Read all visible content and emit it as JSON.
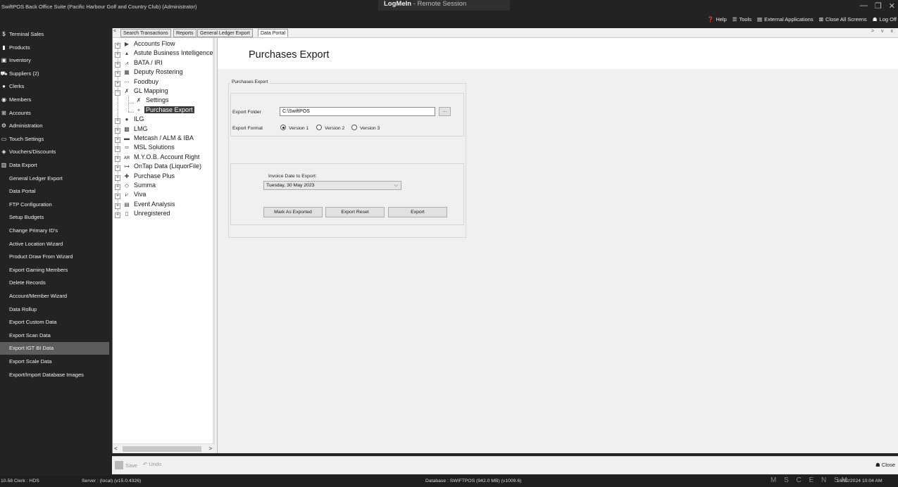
{
  "window": {
    "title": "SwiftPOS Back Office Suite (Pacific Harbour Golf and Country Club) (Administrator)",
    "remote_app": "LogMeIn",
    "remote_label": "Remote Session",
    "controls": [
      "—",
      "❐",
      "✕"
    ]
  },
  "toolbar": {
    "help": "Help",
    "tools": "Tools",
    "external": "External Applications",
    "close_all": "Close All Screens",
    "log_off": "Log Off"
  },
  "sidebar": {
    "items": [
      {
        "label": "Terminal Sales",
        "icon": "$"
      },
      {
        "label": "Products",
        "icon": "▮"
      },
      {
        "label": "Inventory",
        "icon": "▣"
      },
      {
        "label": "Suppliers (2)",
        "icon": "⛟"
      },
      {
        "label": "Clerks",
        "icon": "●"
      },
      {
        "label": "Members",
        "icon": "◉"
      },
      {
        "label": "Accounts",
        "icon": "⊞"
      },
      {
        "label": "Administration",
        "icon": "⚙"
      },
      {
        "label": "Touch Settings",
        "icon": "▭"
      },
      {
        "label": "Vouchers/Discounts",
        "icon": "◈"
      },
      {
        "label": "Data Export",
        "icon": "▥"
      }
    ],
    "subitems": [
      "General Ledger Export",
      "Data Portal",
      "FTP Configuration",
      "Setup Budgets",
      "Change Primary ID's",
      "Active Location Wizard",
      "Product Draw From Wizard",
      "Export Gaming Members",
      "Delete Records",
      "Account/Member Wizard",
      "Data Rollup",
      "Export Custom Data",
      "Export Scan Data",
      "Export IGT BI Data",
      "Export Scale Data",
      "Export/Import Database Images"
    ],
    "selected": "Export IGT BI Data"
  },
  "tabs": {
    "left_arrow": "<",
    "items": [
      "Search Transactions",
      "Reports",
      "General Ledger Export",
      "Data Portal"
    ],
    "active": "Data Portal",
    "controls": "> v x"
  },
  "tree": {
    "items": [
      {
        "label": "Accounts Flow",
        "exp": "+",
        "icon": "▶"
      },
      {
        "label": "Astute Business Intelligence",
        "exp": "+",
        "icon": "▴"
      },
      {
        "label": "BATA / IRI",
        "exp": "+",
        "icon": "⩘"
      },
      {
        "label": "Deputy Rostering",
        "exp": "+",
        "icon": "▦"
      },
      {
        "label": "Foodbuy",
        "exp": "+",
        "icon": "⋯"
      },
      {
        "label": "GL Mapping",
        "exp": "−",
        "icon": "✗"
      },
      {
        "label": "Settings",
        "exp": "",
        "icon": "✗",
        "child": true
      },
      {
        "label": "Purchase Export",
        "exp": "",
        "icon": "⚬",
        "child": true,
        "selected": true
      },
      {
        "label": "ILG",
        "exp": "+",
        "icon": "●"
      },
      {
        "label": "LMG",
        "exp": "+",
        "icon": "▩"
      },
      {
        "label": "Metcash / ALM & IBA",
        "exp": "+",
        "icon": "▬"
      },
      {
        "label": "MSL Solutions",
        "exp": "+",
        "icon": "═"
      },
      {
        "label": "M.Y.O.B. Account Right",
        "exp": "+",
        "icon": "ᴀʀ"
      },
      {
        "label": "OnTap Data (LiquorFile)",
        "exp": "+",
        "icon": "⊶"
      },
      {
        "label": "Purchase Plus",
        "exp": "+",
        "icon": "✚"
      },
      {
        "label": "Summa",
        "exp": "+",
        "icon": "◇"
      },
      {
        "label": "Viva",
        "exp": "+",
        "icon": "⩗"
      },
      {
        "label": "Event Analysis",
        "exp": "+",
        "icon": "▤"
      },
      {
        "label": "Unregistered",
        "exp": "+",
        "icon": "▯"
      }
    ]
  },
  "main": {
    "title": "Purchases Export",
    "group_label": "Purchases Export",
    "export_folder_label": "Export Folder",
    "export_folder_value": "C:\\SwiftPOS",
    "browse_label": "...",
    "export_format_label": "Export Format",
    "formats": [
      "Version 1",
      "Version 2",
      "Version 3"
    ],
    "selected_format": "Version 1",
    "invoice_date_label": "Invoice Date to Export:",
    "invoice_date_value": "Tuesday, 30 May 2023",
    "buttons": {
      "mark": "Mark As Exported",
      "reset": "Export Reset",
      "export": "Export"
    }
  },
  "actionbar": {
    "save": "Save",
    "undo": "Undo",
    "close": "Close"
  },
  "status": {
    "version_clerk": "10.58  Clerk : HDS",
    "server": "Server : (local) (v15.0.4326)",
    "database": "Database : SWIFTPOS (942.0 MB) (v1009.6)",
    "indicators": "M S C E N SM",
    "datetime": "16/02/2024  10:04 AM"
  }
}
